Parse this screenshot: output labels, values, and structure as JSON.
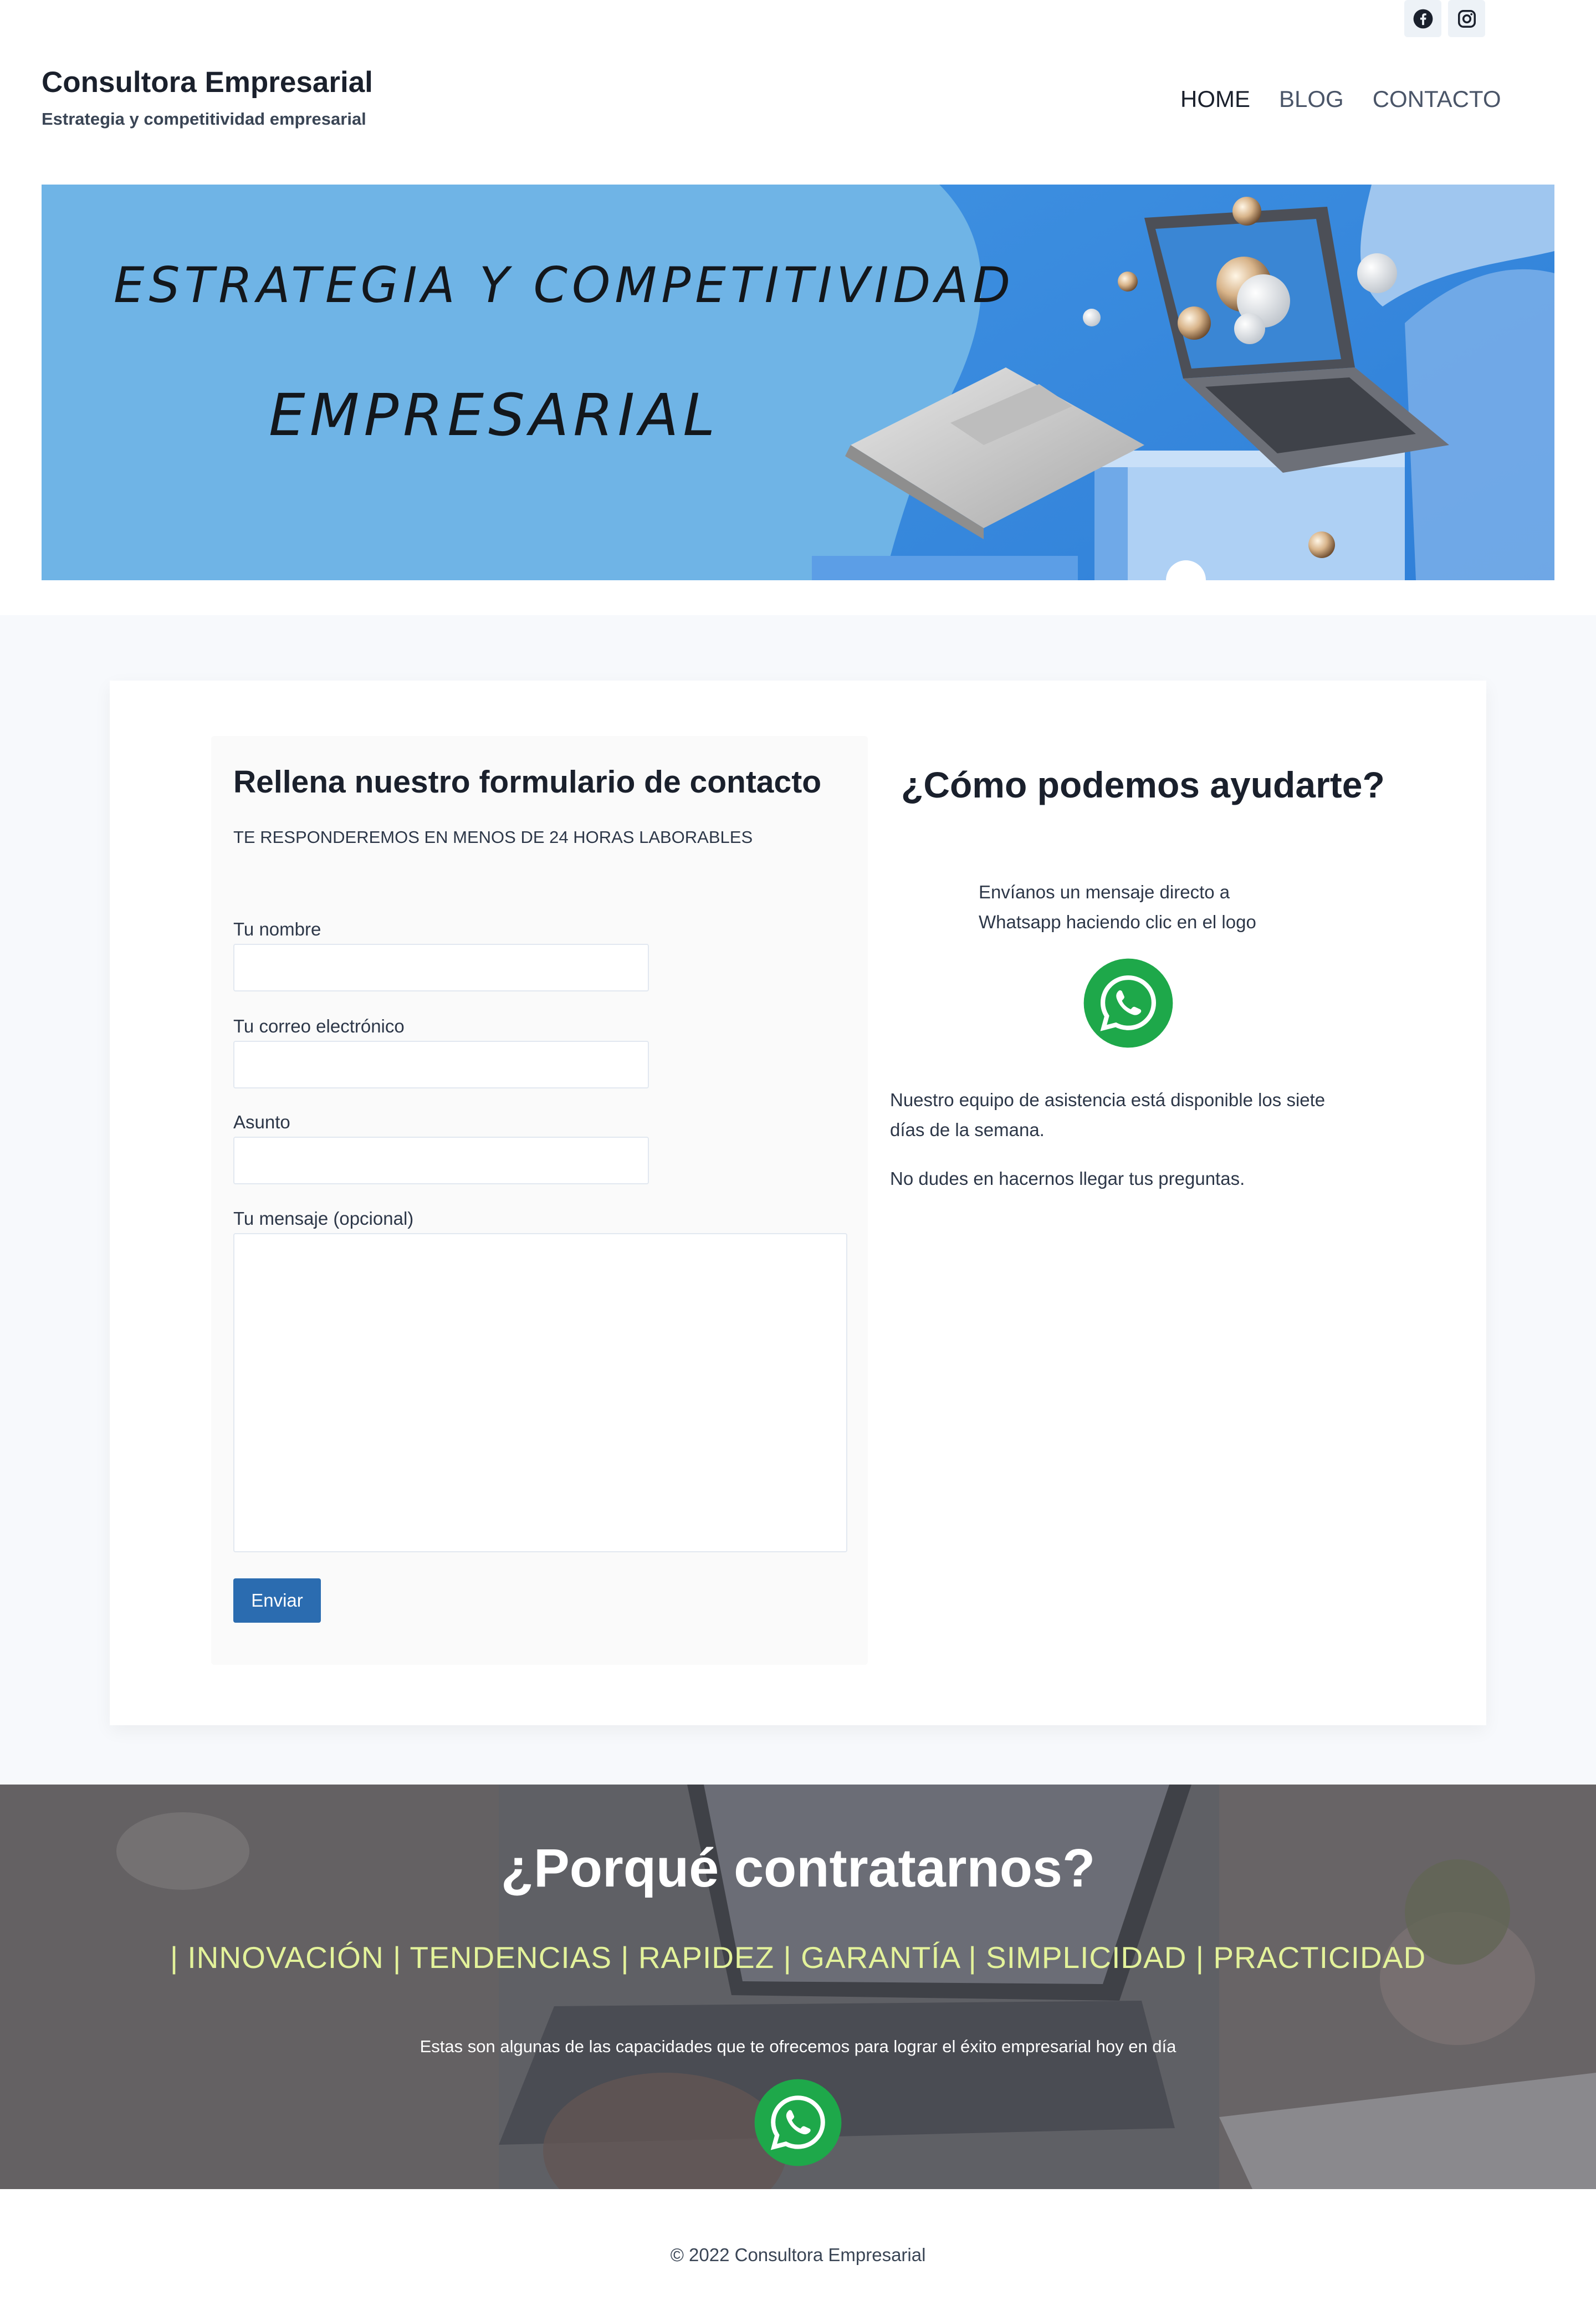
{
  "social": {
    "items": [
      {
        "name": "facebook",
        "icon": "facebook-icon"
      },
      {
        "name": "instagram",
        "icon": "instagram-icon"
      }
    ]
  },
  "header": {
    "site_title": "Consultora Empresarial",
    "tagline": "Estrategia y competitividad empresarial"
  },
  "nav": {
    "items": [
      {
        "label": "HOME",
        "active": true
      },
      {
        "label": "BLOG",
        "active": false
      },
      {
        "label": "CONTACTO",
        "active": false
      }
    ]
  },
  "hero": {
    "line1": "ESTRATEGIA Y COMPETITIVIDAD",
    "line2": "EMPRESARIAL"
  },
  "contact_form": {
    "title": "Rellena nuestro formulario de contacto",
    "subtitle": "TE RESPONDEREMOS EN MENOS DE 24 HORAS LABORABLES",
    "fields": {
      "name_label": "Tu nombre",
      "email_label": "Tu correo electrónico",
      "subject_label": "Asunto",
      "message_label": "Tu mensaje (opcional)"
    },
    "submit_label": "Enviar"
  },
  "help": {
    "title": "¿Cómo podemos ayudarte?",
    "whatsapp_line1": "Envíanos un mensaje directo a",
    "whatsapp_line2": "Whatsapp haciendo clic en el logo",
    "availability_line1": "Nuestro equipo de asistencia está disponible los siete",
    "availability_line2": "días de la semana.",
    "questions": "No dudes en hacernos llegar tus preguntas."
  },
  "why": {
    "title": "¿Porqué contratarnos?",
    "values": "| INNOVACIÓN | TENDENCIAS | RAPIDEZ | GARANTÍA | SIMPLICIDAD | PRACTICIDAD",
    "description": "Estas son algunas de las capacidades que te ofrecemos para lograr el éxito empresarial hoy en día"
  },
  "footer": {
    "copyright": "© 2022 Consultora Empresarial"
  },
  "colors": {
    "whatsapp_green": "#1ea84a",
    "submit_blue": "#2b6cb0",
    "values_yellow": "#e3f29a",
    "hero_blue": "#6fb4e6"
  }
}
